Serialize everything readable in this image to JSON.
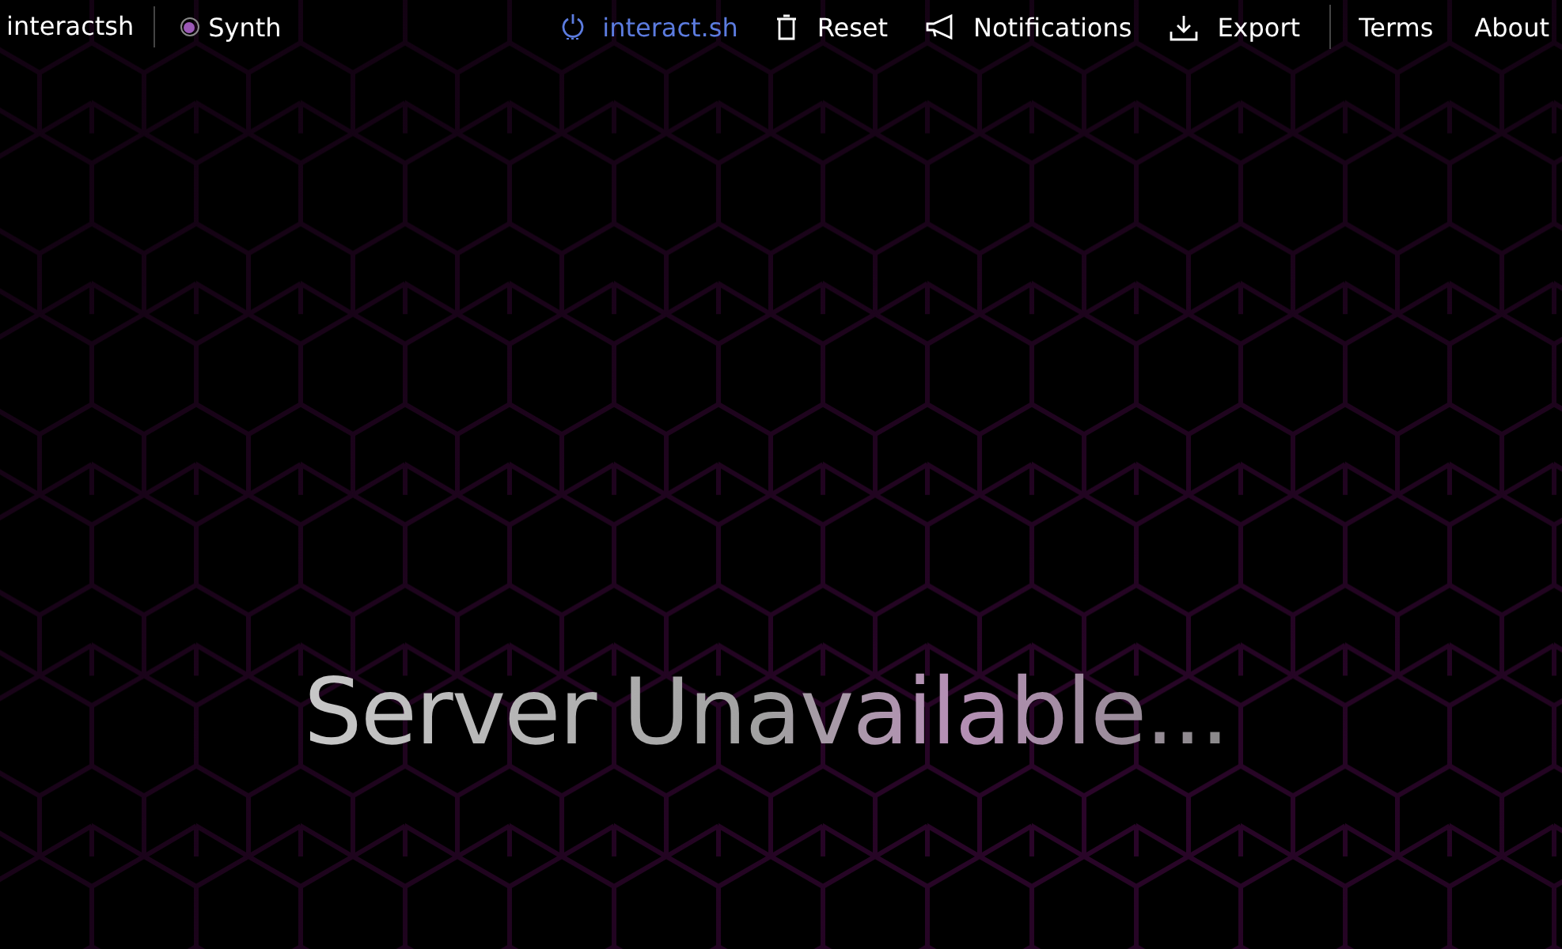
{
  "brand": "interactsh",
  "theme_option": {
    "label": "Synth",
    "selected": true
  },
  "nav_items": [
    {
      "label": "interact.sh",
      "kind": "power",
      "active": true
    },
    {
      "label": "Reset",
      "kind": "trash",
      "active": false
    },
    {
      "label": "Notifications",
      "kind": "megaphone",
      "active": false
    },
    {
      "label": "Export",
      "kind": "download",
      "active": false
    }
  ],
  "links": [
    "Terms",
    "About"
  ],
  "message": "Server Unavailable..."
}
